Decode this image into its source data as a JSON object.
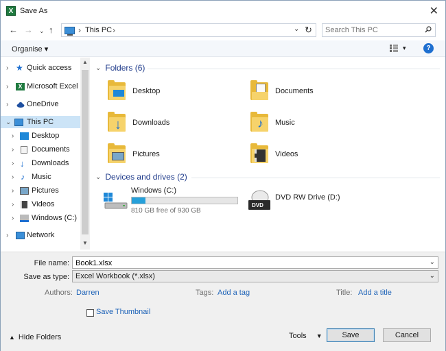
{
  "window": {
    "title": "Save As",
    "app_icon_letter": "X"
  },
  "address": {
    "crumb": "This PC"
  },
  "search": {
    "placeholder": "Search This PC"
  },
  "toolbar": {
    "organise": "Organise ▾"
  },
  "sidebar": {
    "items": [
      {
        "label": "Quick access",
        "icon": "star-icon"
      },
      {
        "label": "Microsoft Excel",
        "icon": "excel-icon"
      },
      {
        "label": "OneDrive",
        "icon": "cloud-icon"
      },
      {
        "label": "This PC",
        "icon": "computer-icon",
        "selected": true
      },
      {
        "label": "Desktop",
        "icon": "desktop-icon"
      },
      {
        "label": "Documents",
        "icon": "document-icon"
      },
      {
        "label": "Downloads",
        "icon": "download-icon"
      },
      {
        "label": "Music",
        "icon": "music-icon"
      },
      {
        "label": "Pictures",
        "icon": "picture-icon"
      },
      {
        "label": "Videos",
        "icon": "video-icon"
      },
      {
        "label": "Windows (C:)",
        "icon": "drive-icon"
      },
      {
        "label": "Network",
        "icon": "network-icon"
      }
    ]
  },
  "folders_group": {
    "title": "Folders (6)",
    "items": [
      {
        "label": "Desktop",
        "icon": "desktop-folder-icon"
      },
      {
        "label": "Documents",
        "icon": "documents-folder-icon"
      },
      {
        "label": "Downloads",
        "icon": "downloads-folder-icon"
      },
      {
        "label": "Music",
        "icon": "music-folder-icon"
      },
      {
        "label": "Pictures",
        "icon": "pictures-folder-icon"
      },
      {
        "label": "Videos",
        "icon": "videos-folder-icon"
      }
    ]
  },
  "drives_group": {
    "title": "Devices and drives (2)",
    "items": [
      {
        "label": "Windows (C:)",
        "free_text": "810 GB free of 930 GB",
        "used_fraction": 0.129
      },
      {
        "label": "DVD RW Drive (D:)"
      }
    ]
  },
  "form": {
    "file_name_label": "File name:",
    "file_name_value": "Book1.xlsx",
    "save_type_label": "Save as type:",
    "save_type_value": "Excel Workbook (*.xlsx)",
    "authors_label": "Authors:",
    "authors_value": "Darren",
    "tags_label": "Tags:",
    "tags_value": "Add a tag",
    "title_label": "Title:",
    "title_value": "Add a title",
    "thumbnail_label": "Save Thumbnail"
  },
  "footer": {
    "hide_folders": "Hide Folders",
    "tools": "Tools",
    "save": "Save",
    "cancel": "Cancel"
  },
  "colors": {
    "accent": "#1e63b8",
    "selection": "#cce4f7",
    "folder": "#e8b93a",
    "drive_fill": "#26a0da"
  }
}
